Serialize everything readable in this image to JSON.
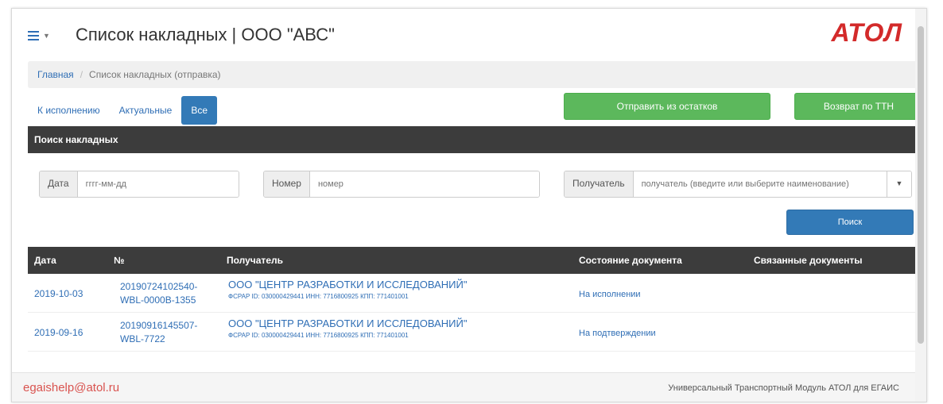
{
  "header": {
    "title": "Список накладных | ООО \"АВС\"",
    "logo": "АТОЛ",
    "menu_icon": "hamburger-icon"
  },
  "breadcrumb": {
    "home": "Главная",
    "current": "Список накладных (отправка)"
  },
  "tabs": [
    {
      "label": "К исполнению",
      "active": false
    },
    {
      "label": "Актуальные",
      "active": false
    },
    {
      "label": "Все",
      "active": true
    }
  ],
  "actions": {
    "send_from_stock": "Отправить из остатков",
    "return_ttn": "Возврат по ТТН"
  },
  "search": {
    "panel_title": "Поиск накладных",
    "date_label": "Дата",
    "date_placeholder": "гггг-мм-дд",
    "number_label": "Номер",
    "number_placeholder": "номер",
    "recipient_label": "Получатель",
    "recipient_placeholder": "получатель (введите или выберите наименование)",
    "button": "Поиск"
  },
  "table": {
    "columns": [
      "Дата",
      "№",
      "Получатель",
      "Состояние документа",
      "Связанные документы"
    ],
    "rows": [
      {
        "date": "2019-10-03",
        "number_line1": "20190724102540-",
        "number_line2": "WBL-0000B-1355",
        "recipient": "ООО \"ЦЕНТР РАЗРАБОТКИ И ИССЛЕДОВАНИЙ\"",
        "recipient_meta": "ФСРАР ID: 030000429441 ИНН: 7716800925 КПП: 771401001",
        "state": "На исполнении",
        "related": ""
      },
      {
        "date": "2019-09-16",
        "number_line1": "20190916145507-",
        "number_line2": "WBL-7722",
        "recipient": "ООО \"ЦЕНТР РАЗРАБОТКИ И ИССЛЕДОВАНИЙ\"",
        "recipient_meta": "ФСРАР ID: 030000429441 ИНН: 7716800925 КПП: 771401001",
        "state": "На подтверждении",
        "related": ""
      }
    ]
  },
  "footer": {
    "email": "egaishelp@atol.ru",
    "product": "Универсальный Транспортный Модуль АТОЛ для ЕГАИС"
  },
  "colors": {
    "accent": "#337ab7",
    "success": "#5cb85c",
    "brand": "#d32a2a",
    "dark_header": "#3c3c3c"
  }
}
